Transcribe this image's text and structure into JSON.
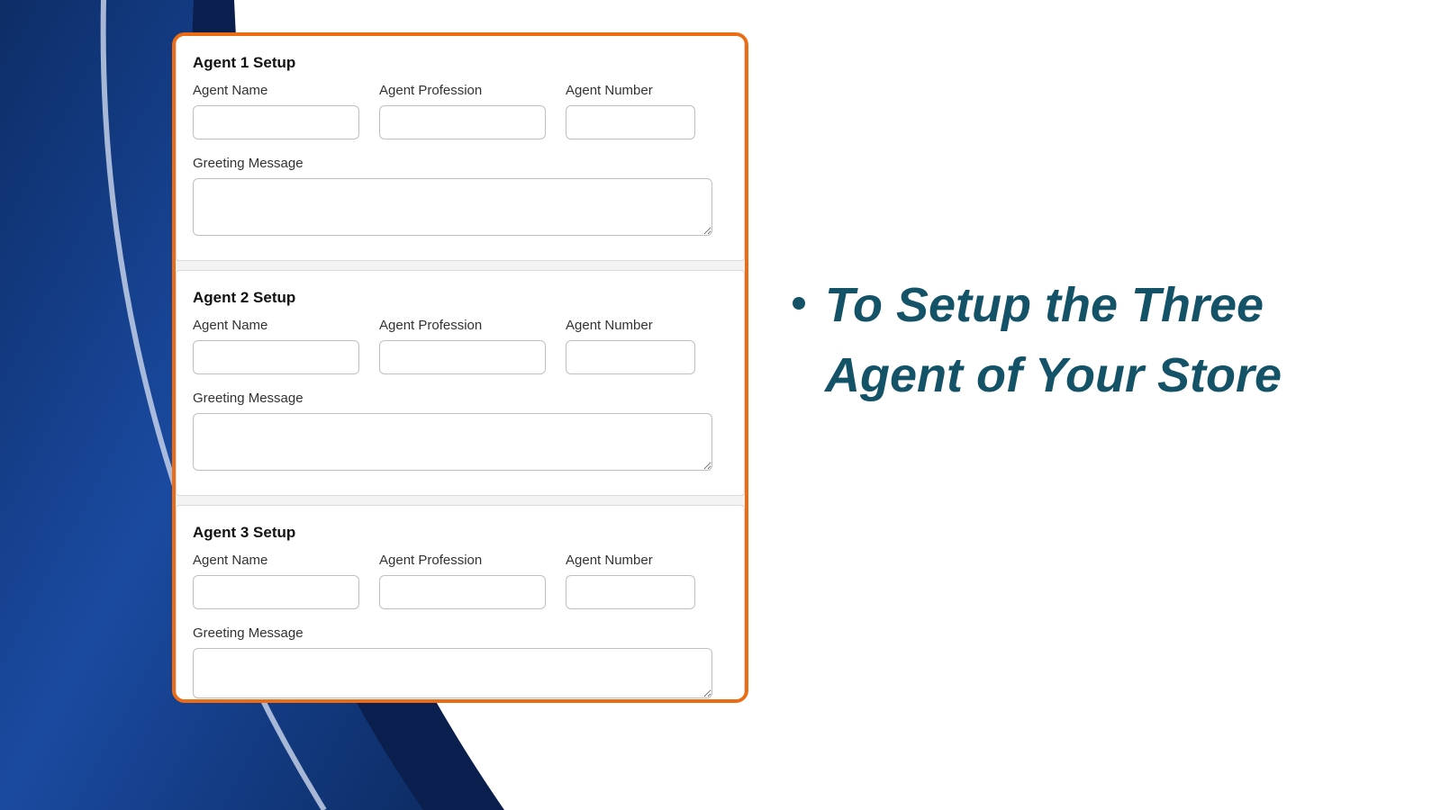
{
  "bullet_text": "To Setup the Three Agent of Your Store",
  "colors": {
    "accent_orange": "#ec6c16",
    "brand_teal": "#145367"
  },
  "agents": [
    {
      "title": "Agent 1 Setup",
      "name_label": "Agent Name",
      "profession_label": "Agent Profession",
      "number_label": "Agent Number",
      "greeting_label": "Greeting Message",
      "name_value": "",
      "profession_value": "",
      "number_value": "",
      "greeting_value": ""
    },
    {
      "title": "Agent 2 Setup",
      "name_label": "Agent Name",
      "profession_label": "Agent Profession",
      "number_label": "Agent Number",
      "greeting_label": "Greeting Message",
      "name_value": "",
      "profession_value": "",
      "number_value": "",
      "greeting_value": ""
    },
    {
      "title": "Agent 3 Setup",
      "name_label": "Agent Name",
      "profession_label": "Agent Profession",
      "number_label": "Agent Number",
      "greeting_label": "Greeting Message",
      "name_value": "",
      "profession_value": "",
      "number_value": "",
      "greeting_value": ""
    }
  ]
}
